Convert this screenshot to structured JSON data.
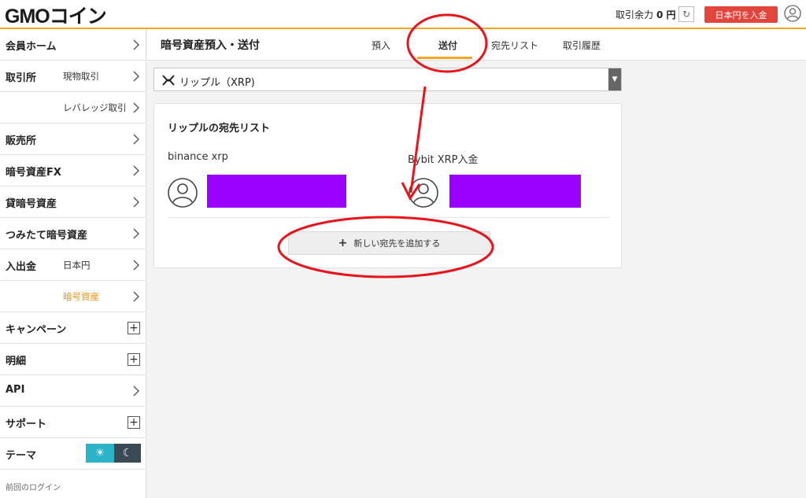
{
  "header": {
    "logo_text": "GMOコイン",
    "balance_label": "取引余力",
    "balance_value": "0 円",
    "deposit_button": "日本円を入金"
  },
  "sidebar": {
    "items": [
      {
        "main": "会員ホーム",
        "sub": "",
        "control": "chevron"
      },
      {
        "main": "取引所",
        "sub": "現物取引",
        "control": "chevron"
      },
      {
        "main": "",
        "sub": "レバレッジ取引",
        "control": "chevron"
      },
      {
        "main": "販売所",
        "sub": "",
        "control": "chevron"
      },
      {
        "main": "暗号資産FX",
        "sub": "",
        "control": "chevron"
      },
      {
        "main": "貸暗号資産",
        "sub": "",
        "control": "chevron"
      },
      {
        "main": "つみたて暗号資産",
        "sub": "",
        "control": "chevron"
      },
      {
        "main": "入出金",
        "sub": "日本円",
        "control": "chevron"
      },
      {
        "main": "",
        "sub": "暗号資産",
        "control": "chevron",
        "active": true
      },
      {
        "main": "キャンペーン",
        "sub": "",
        "control": "plus"
      },
      {
        "main": "明細",
        "sub": "",
        "control": "plus"
      },
      {
        "main": "API",
        "sub": "",
        "control": "chevron"
      },
      {
        "main": "サポート",
        "sub": "",
        "control": "plus"
      },
      {
        "main": "テーマ",
        "sub": "",
        "control": "theme"
      }
    ],
    "last_login_label": "前回のログイン"
  },
  "main": {
    "page_title": "暗号資産預入・送付",
    "tabs": [
      {
        "label": "預入",
        "active": false
      },
      {
        "label": "送付",
        "active": true
      },
      {
        "label": "宛先リスト",
        "active": false
      },
      {
        "label": "取引履歴",
        "active": false
      }
    ],
    "currency_select": "リップル（XRP)",
    "card": {
      "title": "リップルの宛先リスト",
      "addresses": [
        {
          "name": "binance xrp"
        },
        {
          "name": "Bybit XRP入金"
        }
      ],
      "add_button": "新しい宛先を追加する"
    }
  },
  "colors": {
    "accent": "#f5a623",
    "deposit_button": "#e2453c",
    "redaction": "#9900ff",
    "annotation": "#e8141c",
    "active_sub": "#e8951a"
  },
  "icons": {
    "refresh": "refresh-icon",
    "user": "user-icon",
    "xrp": "xrp-icon",
    "avatar": "avatar-icon",
    "chevron": "chevron-right-icon",
    "plus": "plus-icon",
    "sun": "sun-icon",
    "moon": "moon-icon"
  }
}
